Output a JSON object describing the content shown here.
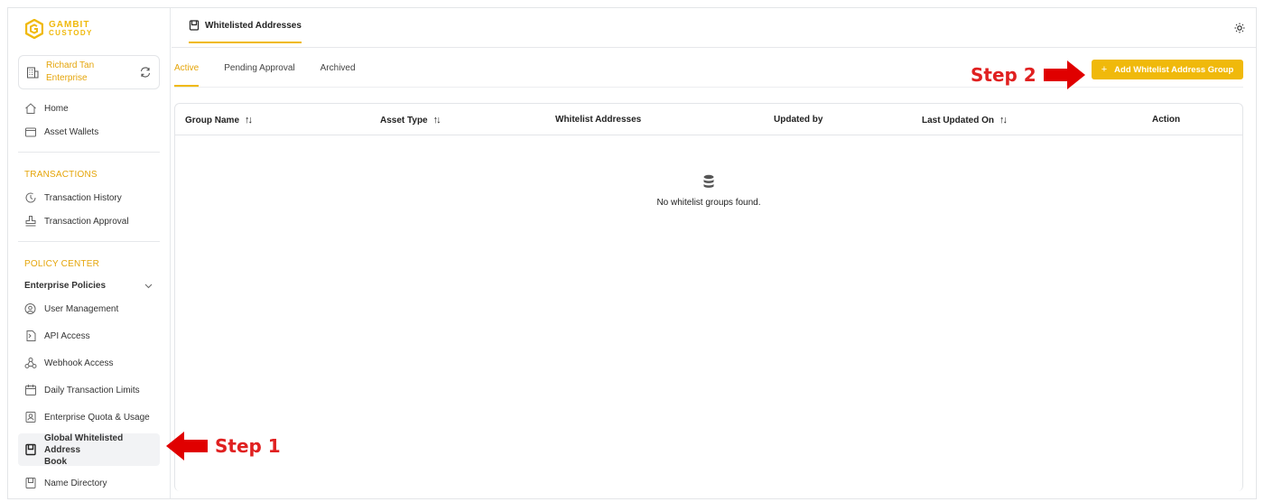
{
  "brand": {
    "name": "GAMBIT",
    "sub": "CUSTODY",
    "accent": "#f0b90b"
  },
  "account": {
    "name": "Richard Tan",
    "org": "Enterprise"
  },
  "sidebar": {
    "top_items": [
      {
        "label": "Home",
        "icon": "home-icon"
      },
      {
        "label": "Asset Wallets",
        "icon": "wallet-icon"
      }
    ],
    "transactions_title": "TRANSACTIONS",
    "transactions": [
      {
        "label": "Transaction History",
        "icon": "history-icon"
      },
      {
        "label": "Transaction Approval",
        "icon": "stamp-icon"
      }
    ],
    "policy_title": "POLICY CENTER",
    "policy_group": "Enterprise Policies",
    "policy_items": [
      {
        "label": "User Management",
        "icon": "user-gear-icon"
      },
      {
        "label": "API Access",
        "icon": "api-icon"
      },
      {
        "label": "Webhook Access",
        "icon": "webhook-icon"
      },
      {
        "label": "Daily Transaction Limits",
        "icon": "calendar-icon"
      },
      {
        "label": "Enterprise Quota & Usage",
        "icon": "quota-icon"
      }
    ],
    "active_item": {
      "line1": "Global Whitelisted Address",
      "line2": "Book"
    },
    "last_item": "Name Directory"
  },
  "header": {
    "page_tab": "Whitelisted Addresses"
  },
  "tabs": [
    "Active",
    "Pending Approval",
    "Archived"
  ],
  "add_button": "Add Whitelist Address Group",
  "table": {
    "columns": [
      "Group Name",
      "Asset Type",
      "Whitelist Addresses",
      "Updated by",
      "Last Updated On",
      "Action"
    ],
    "sort_glyph": "↑↓",
    "empty_message": "No whitelist groups found."
  },
  "annotations": {
    "step1": "Step 1",
    "step2": "Step 2",
    "arrow_color": "#e00000"
  }
}
